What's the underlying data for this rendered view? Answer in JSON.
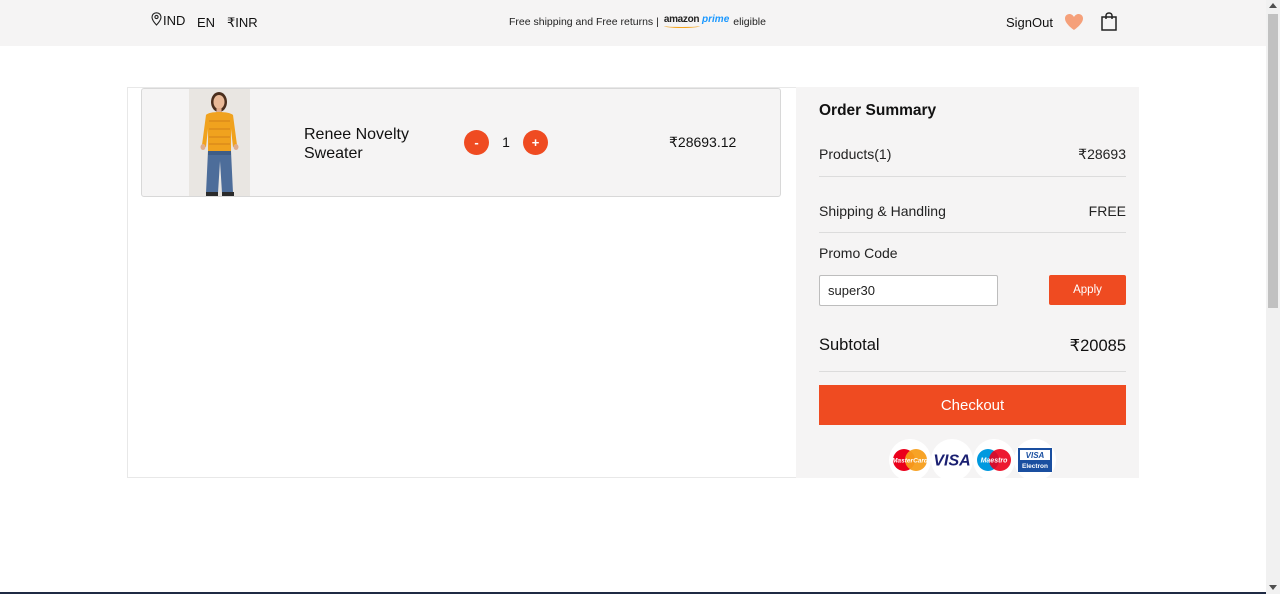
{
  "header": {
    "location": "IND",
    "language": "EN",
    "currency": "₹INR",
    "shipping_text": "Free shipping and Free returns |",
    "prime_amazon": "amazon",
    "prime_word": "prime",
    "eligible_text": "eligible",
    "signout_label": "SignOut"
  },
  "cart": {
    "items": [
      {
        "name": "Renee Novelty Sweater",
        "quantity": "1",
        "price": "₹28693.12",
        "minus_label": "-",
        "plus_label": "+"
      }
    ]
  },
  "summary": {
    "title": "Order Summary",
    "products_label": "Products(1)",
    "products_value": "₹28693",
    "shipping_label": "Shipping & Handling",
    "shipping_value": "FREE",
    "promo_label": "Promo Code",
    "promo_value": "super30",
    "apply_label": "Apply",
    "subtotal_label": "Subtotal",
    "subtotal_value": "₹20085",
    "checkout_label": "Checkout"
  },
  "payment_methods": {
    "mastercard": "MasterCard",
    "visa": "VISA",
    "maestro": "Maestro",
    "visa_electron_top": "VISA",
    "visa_electron_bottom": "Electron"
  },
  "colors": {
    "accent": "#ef4b21",
    "panel_bg": "#f5f4f4",
    "heart": "#f5a07a"
  }
}
